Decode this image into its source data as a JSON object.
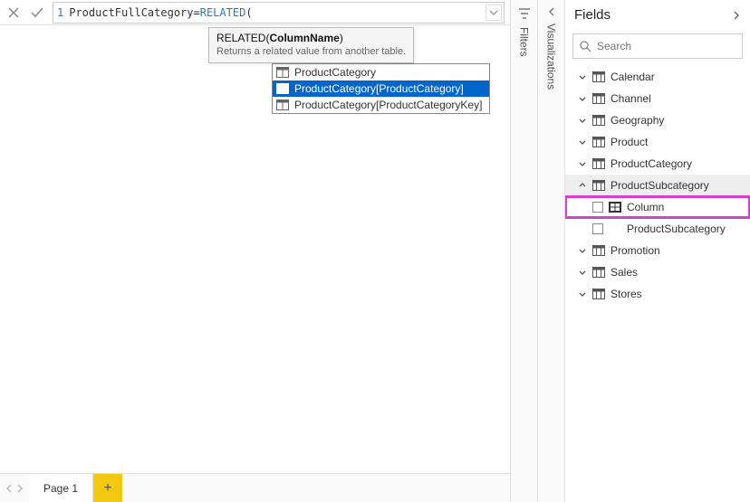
{
  "formula": {
    "line_number": "1",
    "prefix": "ProductFullCategory=",
    "func": "RELATED",
    "suffix": "("
  },
  "tooltip": {
    "func": "RELATED",
    "open": "(",
    "param": "ColumnName",
    "close": ")",
    "description": "Returns a related value from another table."
  },
  "suggestions": [
    {
      "label": "ProductCategory",
      "selected": false
    },
    {
      "label": "ProductCategory[ProductCategory]",
      "selected": true
    },
    {
      "label": "ProductCategory[ProductCategoryKey]",
      "selected": false
    }
  ],
  "rails": {
    "filters": "Filters",
    "visualizations": "Visualizations"
  },
  "tabs": {
    "page1": "Page 1"
  },
  "fields": {
    "title": "Fields",
    "search_placeholder": "Search",
    "items": [
      {
        "label": "Calendar",
        "expanded": false,
        "type": "table"
      },
      {
        "label": "Channel",
        "expanded": false,
        "type": "table"
      },
      {
        "label": "Geography",
        "expanded": false,
        "type": "table"
      },
      {
        "label": "Product",
        "expanded": false,
        "type": "table"
      },
      {
        "label": "ProductCategory",
        "expanded": false,
        "type": "table"
      },
      {
        "label": "ProductSubcategory",
        "expanded": true,
        "type": "table",
        "active": true,
        "children": [
          {
            "label": "Column",
            "highlight": true,
            "icon": true
          },
          {
            "label": "ProductSubcategory",
            "highlight": false,
            "icon": false
          }
        ]
      },
      {
        "label": "Promotion",
        "expanded": false,
        "type": "table"
      },
      {
        "label": "Sales",
        "expanded": false,
        "type": "table"
      },
      {
        "label": "Stores",
        "expanded": false,
        "type": "table"
      }
    ]
  }
}
